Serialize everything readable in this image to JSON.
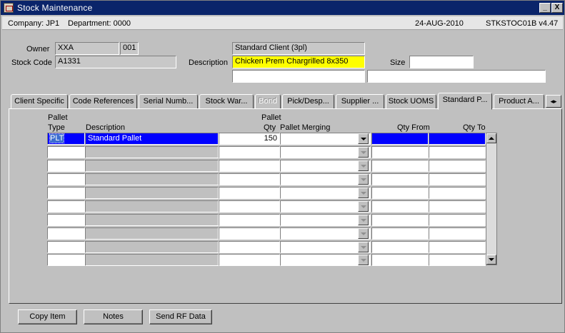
{
  "window": {
    "title": "Stock Maintenance",
    "minimize_label": "_",
    "close_label": "X"
  },
  "infobar": {
    "company": "Company: JP1",
    "department": "Department: 0000",
    "date": "24-AUG-2010",
    "version": "STKSTOC01B v4.47"
  },
  "form": {
    "owner_label": "Owner",
    "owner_code": "XXA",
    "owner_num": "001",
    "owner_name": "Standard Client (3pl)",
    "stock_code_label": "Stock Code",
    "stock_code": "A1331",
    "description_label": "Description",
    "description": "Chicken Prem Chargrilled 8x350",
    "description2": "",
    "description3": "",
    "size_label": "Size",
    "size": ""
  },
  "tabs": [
    {
      "label": "Client Specific"
    },
    {
      "label": "Code References"
    },
    {
      "label": "Serial Numb..."
    },
    {
      "label": "Stock War..."
    },
    {
      "label": "Bond"
    },
    {
      "label": "Pick/Desp..."
    },
    {
      "label": "Supplier ..."
    },
    {
      "label": "Stock UOMS"
    },
    {
      "label": "Standard P..."
    },
    {
      "label": "Product A..."
    }
  ],
  "tab_scroll_label": "◂▸",
  "grid": {
    "headers": {
      "pallet_type_1": "Pallet",
      "pallet_type_2": "Type",
      "description": "Description",
      "pallet_qty_1": "Pallet",
      "pallet_qty_2": "Qty",
      "pallet_merging": "Pallet Merging",
      "qty_from": "Qty From",
      "qty_to": "Qty To"
    },
    "rows": [
      {
        "type": "PLT",
        "description": "Standard Pallet",
        "qty": "150",
        "merging": "",
        "qty_from": "",
        "qty_to": ""
      }
    ]
  },
  "buttons": {
    "copy_item": "Copy Item",
    "notes": "Notes",
    "send_rf": "Send RF Data"
  }
}
